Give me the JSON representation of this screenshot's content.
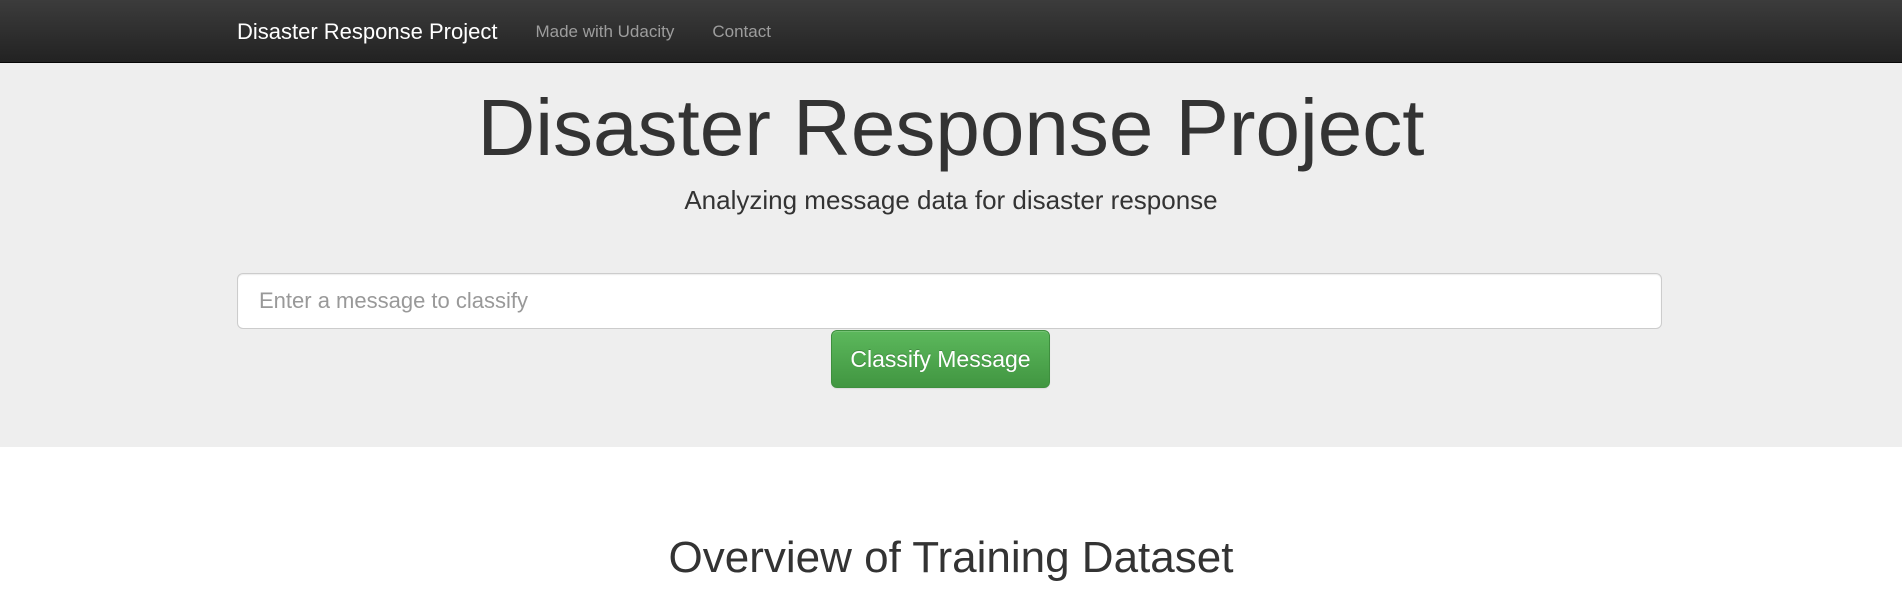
{
  "navbar": {
    "brand": "Disaster Response Project",
    "links": [
      {
        "label": "Made with Udacity"
      },
      {
        "label": "Contact"
      }
    ]
  },
  "hero": {
    "title": "Disaster Response Project",
    "subtitle": "Analyzing message data for disaster response"
  },
  "classifier": {
    "input_value": "",
    "input_placeholder": "Enter a message to classify",
    "button_label": "Classify Message"
  },
  "overview": {
    "title": "Overview of Training Dataset"
  },
  "colors": {
    "navbar_top": "#3c3c3c",
    "navbar_bottom": "#222222",
    "jumbotron_bg": "#eeeeee",
    "button_green": "#5cb85c",
    "text_dark": "#333333",
    "nav_link_gray": "#9d9d9d"
  }
}
